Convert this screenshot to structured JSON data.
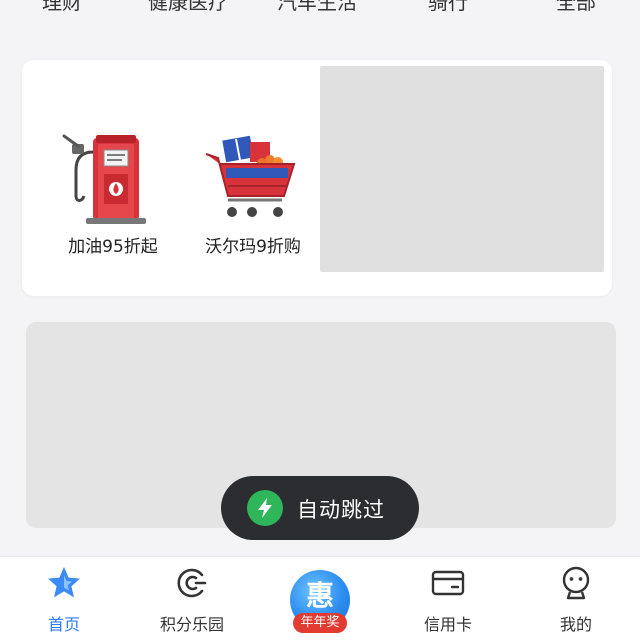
{
  "top_tabs": [
    "理财",
    "健康医疗",
    "汽车生活",
    "骑行",
    "全部"
  ],
  "promo": {
    "items": [
      {
        "label": "加油95折起",
        "icon": "fuel-pump-icon"
      },
      {
        "label": "沃尔玛9折购",
        "icon": "shopping-cart-icon"
      }
    ]
  },
  "toast": {
    "text": "自动跳过",
    "icon": "lightning-icon"
  },
  "bottom_nav": {
    "items": [
      {
        "label": "首页",
        "icon": "star-icon",
        "active": true
      },
      {
        "label": "积分乐园",
        "icon": "points-icon",
        "active": false
      },
      {
        "label": "信用卡",
        "icon": "card-icon",
        "active": false
      },
      {
        "label": "我的",
        "icon": "profile-icon",
        "active": false
      }
    ],
    "center": {
      "glyph": "惠",
      "ribbon": "年年奖"
    }
  },
  "colors": {
    "accent": "#2f7cf6",
    "toast_bg": "#2b2d30",
    "toast_icon": "#2fb55a",
    "ribbon": "#e23b32"
  }
}
